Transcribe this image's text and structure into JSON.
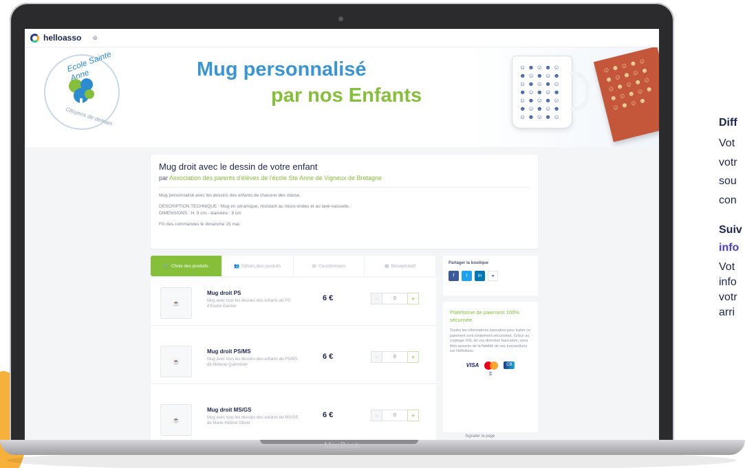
{
  "colors": {
    "accent_green": "#86bf3a",
    "accent_blue": "#3a96d2",
    "navy": "#1c2450"
  },
  "device": {
    "brand": "MacBook"
  },
  "site": {
    "logo": "helloasso",
    "lang_icon": "globe-icon"
  },
  "banner": {
    "school_name": "Ecole Sainte Anne",
    "school_tagline": "Citoyens de demain",
    "title_line1": "Mug personnalisé",
    "title_line2": "par nos Enfants"
  },
  "shop": {
    "title": "Mug droit avec le dessin de votre enfant",
    "by_prefix": "par",
    "organizer": "Association des parents d'élèves de l'école Ste Anne de Vigneux de Bretagne",
    "desc1": "Mug personnalisé avec les dessins des enfants de chacune des classe.",
    "desc2": "DESCRIPTION TECHNIQUE : Mug en céramique, résistant au micro-ondes et au lave-vaisselle.",
    "desc3": "DIMENSIONS : H. 9 cm - diamètre : 8 cm",
    "desc4": "Fin des commandes le dimanche 15 mai."
  },
  "steps": [
    "Choix des produits",
    "Détails des produits",
    "Coordonnées",
    "Récapitulatif"
  ],
  "products": [
    {
      "name": "Mug droit PS",
      "desc": "Mug avec tous les dessins des enfants de PS d'Elodie Garnier",
      "price": "6 €",
      "qty": "0"
    },
    {
      "name": "Mug droit PS/MS",
      "desc": "Mug avec tous les dessins des enfants de PS/MS de Mélanie Quéméner",
      "price": "6 €",
      "qty": "0"
    },
    {
      "name": "Mug droit MS/GS",
      "desc": "Mug avec tous les dessins des enfants de MS/GS de Marie-Hélène Olivier",
      "price": "6 €",
      "qty": "0"
    }
  ],
  "share": {
    "title": "Partager la boutique"
  },
  "payment": {
    "title": "Plateforme de paiement 100% sécurisée",
    "desc": "Toutes les informations bancaires pour traiter ce paiement sont totalement sécurisées. Grâce au cryptage SSL de vos données bancaires, vous êtes assurés de la fiabilité de vos transactions sur HelloAsso.",
    "visa": "VISA"
  },
  "report": "Signaler la page",
  "side_text": [
    "Diff",
    "Vot",
    "votr",
    "sou",
    "con",
    "Suiv",
    "info",
    "Vot",
    "info",
    "votr",
    "arri"
  ]
}
